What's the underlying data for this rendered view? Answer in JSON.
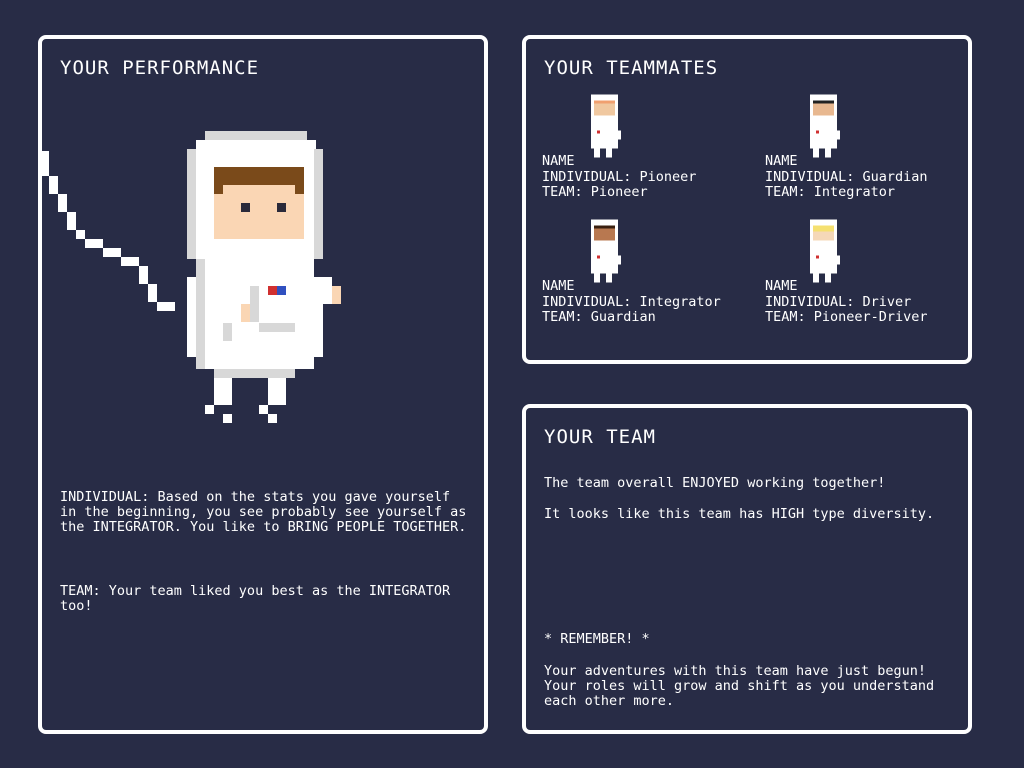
{
  "performance": {
    "title": "YOUR PERFORMANCE",
    "individual": "INDIVIDUAL: Based on the stats you gave yourself in the beginning, you see probably see yourself as the INTEGRATOR. You like to BRING PEOPLE TOGETHER.",
    "team": "TEAM: Your team liked you best as the INTEGRATOR too!"
  },
  "teammates": {
    "title": "YOUR TEAMMATES",
    "list": [
      {
        "name": "NAME",
        "individual": "INDIVIDUAL: Pioneer",
        "team": "TEAM: Pioneer",
        "skin": "#f0c8a0",
        "hair": "#f0a070"
      },
      {
        "name": "NAME",
        "individual": "INDIVIDUAL: Guardian",
        "team": "TEAM: Integrator",
        "skin": "#e8b890",
        "hair": "#222222"
      },
      {
        "name": "NAME",
        "individual": "INDIVIDUAL: Integrator",
        "team": "TEAM: Guardian",
        "skin": "#b87850",
        "hair": "#3a2010"
      },
      {
        "name": "NAME",
        "individual": "INDIVIDUAL: Driver",
        "team": "TEAM: Pioneer-Driver",
        "skin": "#f5d8b8",
        "hair": "#f5e070"
      }
    ]
  },
  "team": {
    "title": "YOUR TEAM",
    "line1": "The team overall ENJOYED working together!",
    "line2": "It looks like this team has HIGH type diversity.",
    "remember": "* REMEMBER! *",
    "closing": "Your adventures with this team have just begun! Your roles will grow and shift as you understand each other more."
  },
  "colors": {
    "background": "#282c46",
    "panel_border": "#ffffff",
    "suit": "#ffffff",
    "suit_shade": "#d8d8d8",
    "player_skin": "#fad6b4",
    "player_hair": "#7a4a1a",
    "patch_red": "#d03030",
    "patch_blue": "#3050c0"
  },
  "icons": {
    "player": "astronaut-player-icon",
    "teammate": "astronaut-teammate-icon"
  }
}
